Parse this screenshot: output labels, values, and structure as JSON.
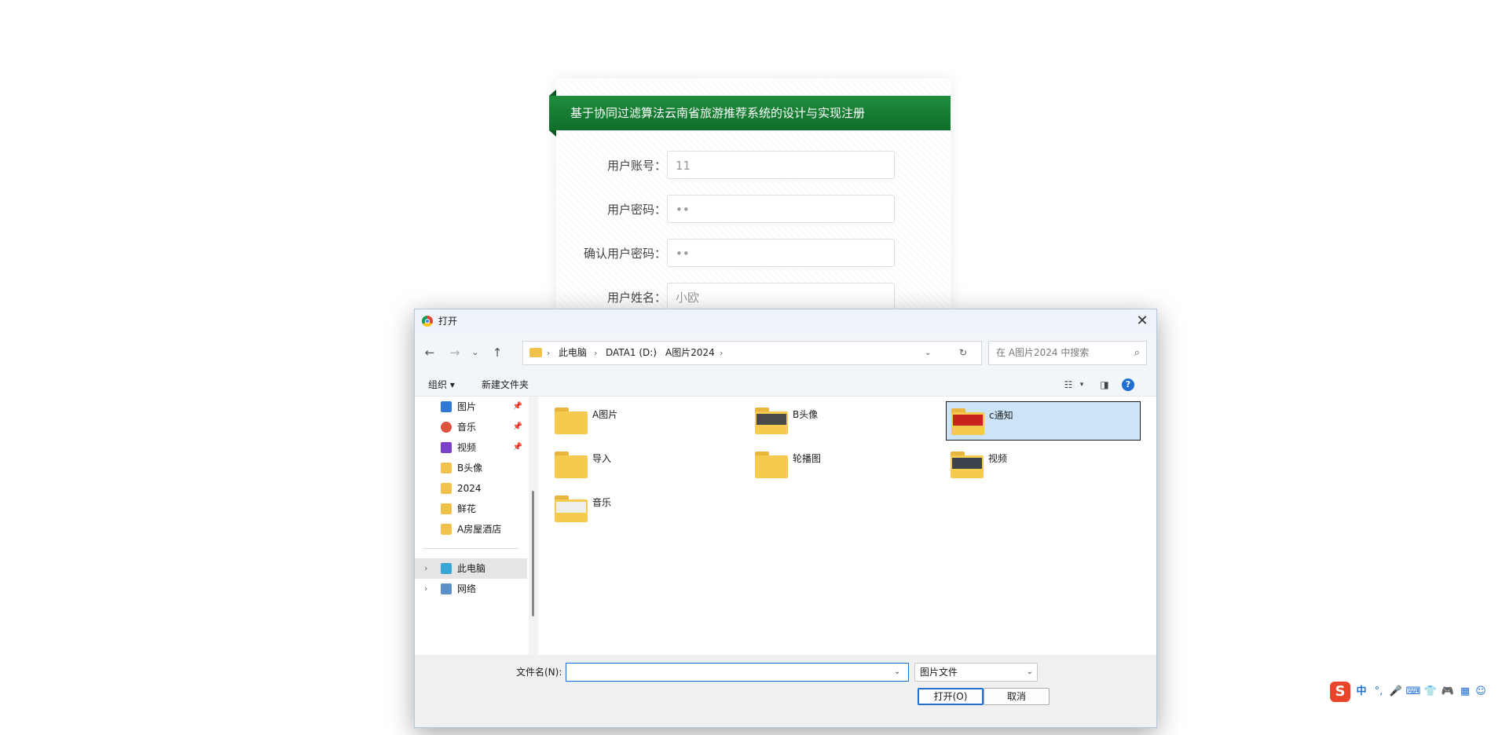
{
  "register": {
    "title": "基于协同过滤算法云南省旅游推荐系统的设计与实现注册",
    "fields": [
      {
        "label": "用户账号：",
        "value": "11"
      },
      {
        "label": "用户密码：",
        "value": "••"
      },
      {
        "label": "确认用户密码：",
        "value": "••"
      },
      {
        "label": "用户姓名：",
        "value": "小欧"
      }
    ]
  },
  "dialog": {
    "title": "打开",
    "breadcrumb": [
      "此电脑",
      "DATA1 (D:)",
      "A图片2024"
    ],
    "search_placeholder": "在 A图片2024 中搜索",
    "toolbar": {
      "organize": "组织 ▾",
      "new_folder": "新建文件夹",
      "help": "?"
    },
    "sidebar": [
      {
        "label": "图片",
        "icon": "pictures-icon",
        "color": "#2f78d6",
        "pinned": true
      },
      {
        "label": "音乐",
        "icon": "music-icon",
        "color": "#e0533f",
        "pinned": true
      },
      {
        "label": "视频",
        "icon": "video-icon",
        "color": "#7b3fc9",
        "pinned": true
      },
      {
        "label": "B头像",
        "icon": "folder-icon",
        "color": "#f1c24b",
        "pinned": false
      },
      {
        "label": "2024",
        "icon": "folder-icon",
        "color": "#f1c24b",
        "pinned": false
      },
      {
        "label": "鲜花",
        "icon": "folder-icon",
        "color": "#f1c24b",
        "pinned": false
      },
      {
        "label": "A房屋酒店",
        "icon": "folder-icon",
        "color": "#f1c24b",
        "pinned": false
      }
    ],
    "sidebar_bottom": [
      {
        "label": "此电脑",
        "icon": "this-pc-icon"
      },
      {
        "label": "网络",
        "icon": "network-icon"
      }
    ],
    "files": [
      {
        "name": "A图片",
        "preview": ""
      },
      {
        "name": "B头像",
        "preview": "#4a4a4a"
      },
      {
        "name": "c通知",
        "preview": "#c9231e",
        "selected": true
      },
      {
        "name": "导入",
        "preview": ""
      },
      {
        "name": "轮播图",
        "preview": ""
      },
      {
        "name": "视频",
        "preview": "#3d4450"
      },
      {
        "name": "音乐",
        "preview": "#eeeeee"
      }
    ],
    "filename_label": "文件名(N):",
    "filename_value": "",
    "filetype": "图片文件",
    "open_button": "打开(O)",
    "cancel_button": "取消"
  },
  "ime": {
    "logo": "S",
    "lang": "中",
    "punct": "°,"
  }
}
